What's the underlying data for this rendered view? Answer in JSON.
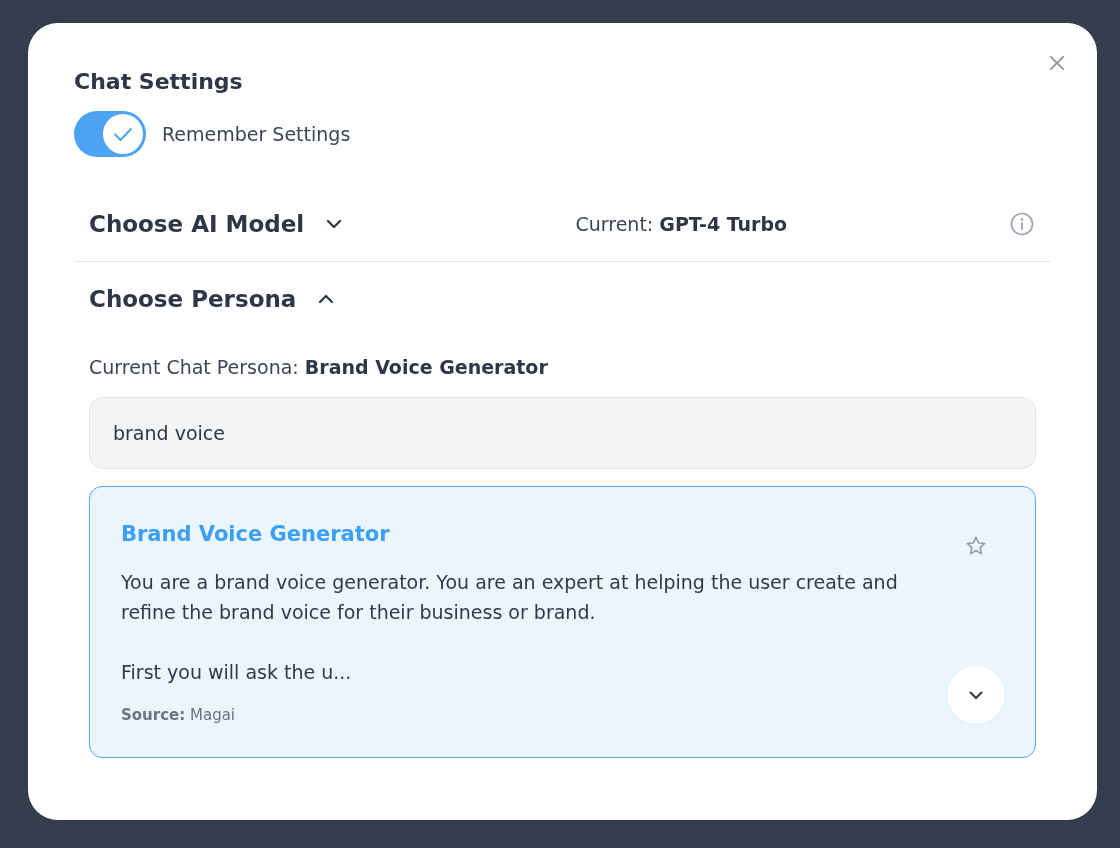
{
  "dialog": {
    "title": "Chat Settings",
    "remember_settings": {
      "label": "Remember Settings",
      "on": true
    },
    "sections": [
      {
        "kind": "model",
        "title": "Choose AI Model",
        "expanded": false,
        "current": "Current: **GPT-4 Turbo**"
      },
      {
        "kind": "persona",
        "title": "Choose Persona",
        "expanded": true,
        "current": "Current Chat Persona: **Brand Voice Generator**",
        "search": {
          "value": "brand voice"
        },
        "personas": [
          {
            "name": "Brand Voice Generator",
            "selected": true,
            "favorite": false,
            "description": "You are a brand voice generator. You are an expert at helping the user create and refine the brand voice for their business or brand.\n\nFirst you will ask the u...",
            "source": "**Source:** Magai"
          }
        ]
      }
    ]
  }
}
